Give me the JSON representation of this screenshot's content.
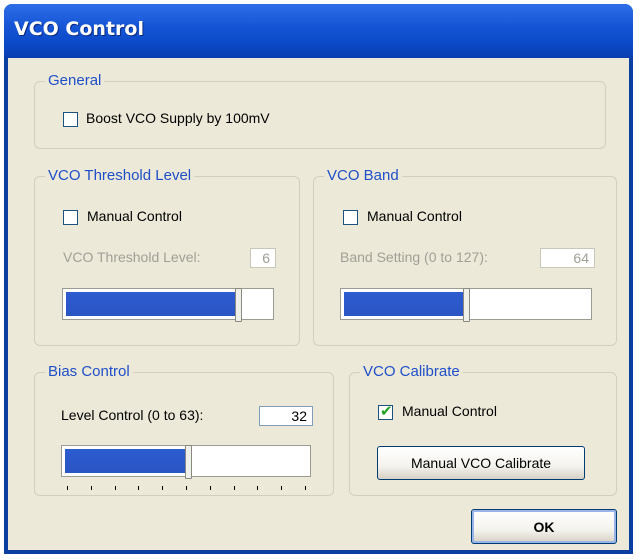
{
  "window": {
    "title": "VCO Control"
  },
  "general": {
    "legend": "General",
    "boost_label": "Boost VCO Supply by 100mV",
    "boost_checked": false
  },
  "threshold": {
    "legend": "VCO Threshold Level",
    "manual_label": "Manual Control",
    "manual_checked": false,
    "level_label": "VCO Threshold Level:",
    "level_value": "6",
    "slider_fraction": 0.86
  },
  "band": {
    "legend": "VCO Band",
    "manual_label": "Manual Control",
    "manual_checked": false,
    "setting_label": "Band Setting (0 to 127):",
    "setting_value": "64",
    "slider_fraction": 0.5
  },
  "bias": {
    "legend": "Bias Control",
    "level_label": "Level Control (0 to 63):",
    "level_value": "32",
    "slider_fraction": 0.51
  },
  "calibrate": {
    "legend": "VCO Calibrate",
    "manual_label": "Manual Control",
    "manual_checked": true,
    "button_label": "Manual VCO Calibrate"
  },
  "ok_label": "OK"
}
